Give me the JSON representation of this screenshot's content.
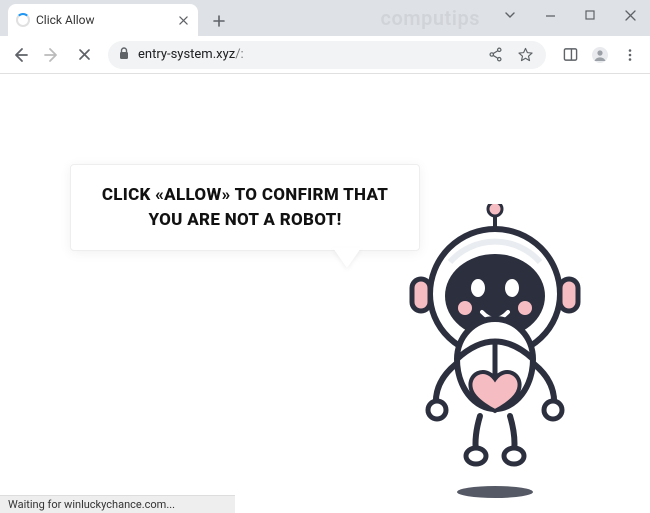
{
  "tab": {
    "title": "Click Allow"
  },
  "address": {
    "host": "entry-system.xyz",
    "path": "/:"
  },
  "watermark": "computips",
  "speech": {
    "text": "CLICK «ALLOW» TO CONFIRM THAT YOU ARE NOT A ROBOT!"
  },
  "status": {
    "text": "Waiting for winluckychance.com..."
  }
}
